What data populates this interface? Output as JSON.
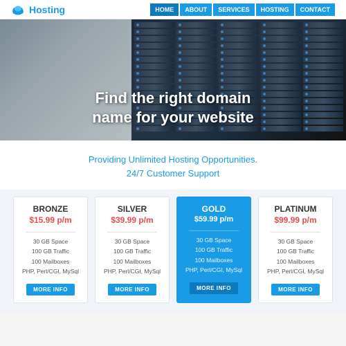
{
  "header": {
    "logo_text": "Hosting",
    "nav_items": [
      {
        "label": "Home",
        "active": true
      },
      {
        "label": "About",
        "active": false
      },
      {
        "label": "Services",
        "active": false
      },
      {
        "label": "Hosting",
        "active": false
      },
      {
        "label": "Contact",
        "active": false
      }
    ]
  },
  "hero": {
    "headline_line1": "Find the right domain",
    "headline_line2": "name for your website"
  },
  "subtitle": {
    "line1": "Providing Unlimited Hosting Opportunities.",
    "line2": "24/7 Customer Support"
  },
  "plans": [
    {
      "name": "Bronze",
      "price": "$15.99 p/m",
      "features": [
        "30 GB Space",
        "100 GB Traffic",
        "100 Mailboxes",
        "PHP, Perl/CGI, MySql"
      ],
      "highlight": false,
      "btn_label": "More Info"
    },
    {
      "name": "Silver",
      "price": "$39.99 p/m",
      "features": [
        "30 GB Space",
        "100 GB Traffic",
        "100 Mailboxes",
        "PHP, Perl/CGI, MySql"
      ],
      "highlight": false,
      "btn_label": "More Info"
    },
    {
      "name": "Gold",
      "price": "$59.99 p/m",
      "features": [
        "30 GB Space",
        "100 GB Traffic",
        "100 Mailboxes",
        "PHP, Perl/CGI, MySql"
      ],
      "highlight": true,
      "btn_label": "More Info"
    },
    {
      "name": "Platinum",
      "price": "$99.99 p/m",
      "features": [
        "30 GB Space",
        "100 GB Traffic",
        "100 Mailboxes",
        "PHP, Perl/CGI, MySql"
      ],
      "highlight": false,
      "btn_label": "More Info"
    }
  ],
  "colors": {
    "accent": "#1a9be6",
    "price_red": "#e84c4c",
    "dark": "#333"
  }
}
